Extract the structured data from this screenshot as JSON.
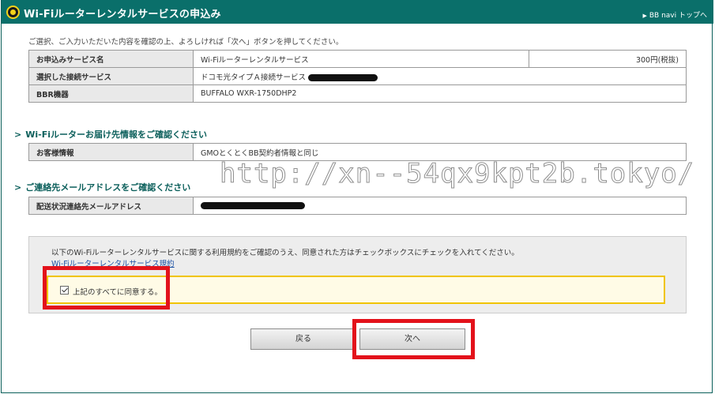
{
  "header": {
    "title": "Wi-Fiルーターレンタルサービスの申込み",
    "nav_link": "BB navi トップへ"
  },
  "intro": "ご選択、ご入力いただいた内容を確認の上、よろしければ「次へ」ボタンを押してください。",
  "summary_rows": [
    {
      "label": "お申込みサービス名",
      "value": "Wi-Fiルーターレンタルサービス",
      "price": "300円(税抜)"
    },
    {
      "label": "選択した接続サービス",
      "value": "ドコモ光タイプＡ接続サービス"
    },
    {
      "label": "BBR機器",
      "value": "BUFFALO WXR-1750DHP2"
    }
  ],
  "delivery_section": {
    "title": "Wi-Fiルーターお届け先情報をご確認ください",
    "rows": [
      {
        "label": "お客様情報",
        "value": "GMOとくとくBB契約者情報と同じ"
      }
    ]
  },
  "email_section": {
    "title": "ご連絡先メールアドレスをご確認ください",
    "rows": [
      {
        "label": "配送状況連絡先メールアドレス",
        "value": ""
      }
    ]
  },
  "watermark": "http://xn--54qx9kpt2b.tokyo/",
  "terms": {
    "text": "以下のWi-Fiルーターレンタルサービスに関する利用規約をご確認のうえ、同意された方はチェックボックスにチェックを入れてください。",
    "link_label": "Wi-Fiルーターレンタルサービス規約",
    "agree_label": "上記のすべてに同意する。",
    "agree_checked": true
  },
  "buttons": {
    "back_label": "戻る",
    "next_label": "次へ"
  },
  "colors": {
    "header_bg": "#0a6f6a",
    "accent": "#0b5f5b",
    "highlight_red": "#e3121b",
    "agree_border": "#f0c400"
  }
}
